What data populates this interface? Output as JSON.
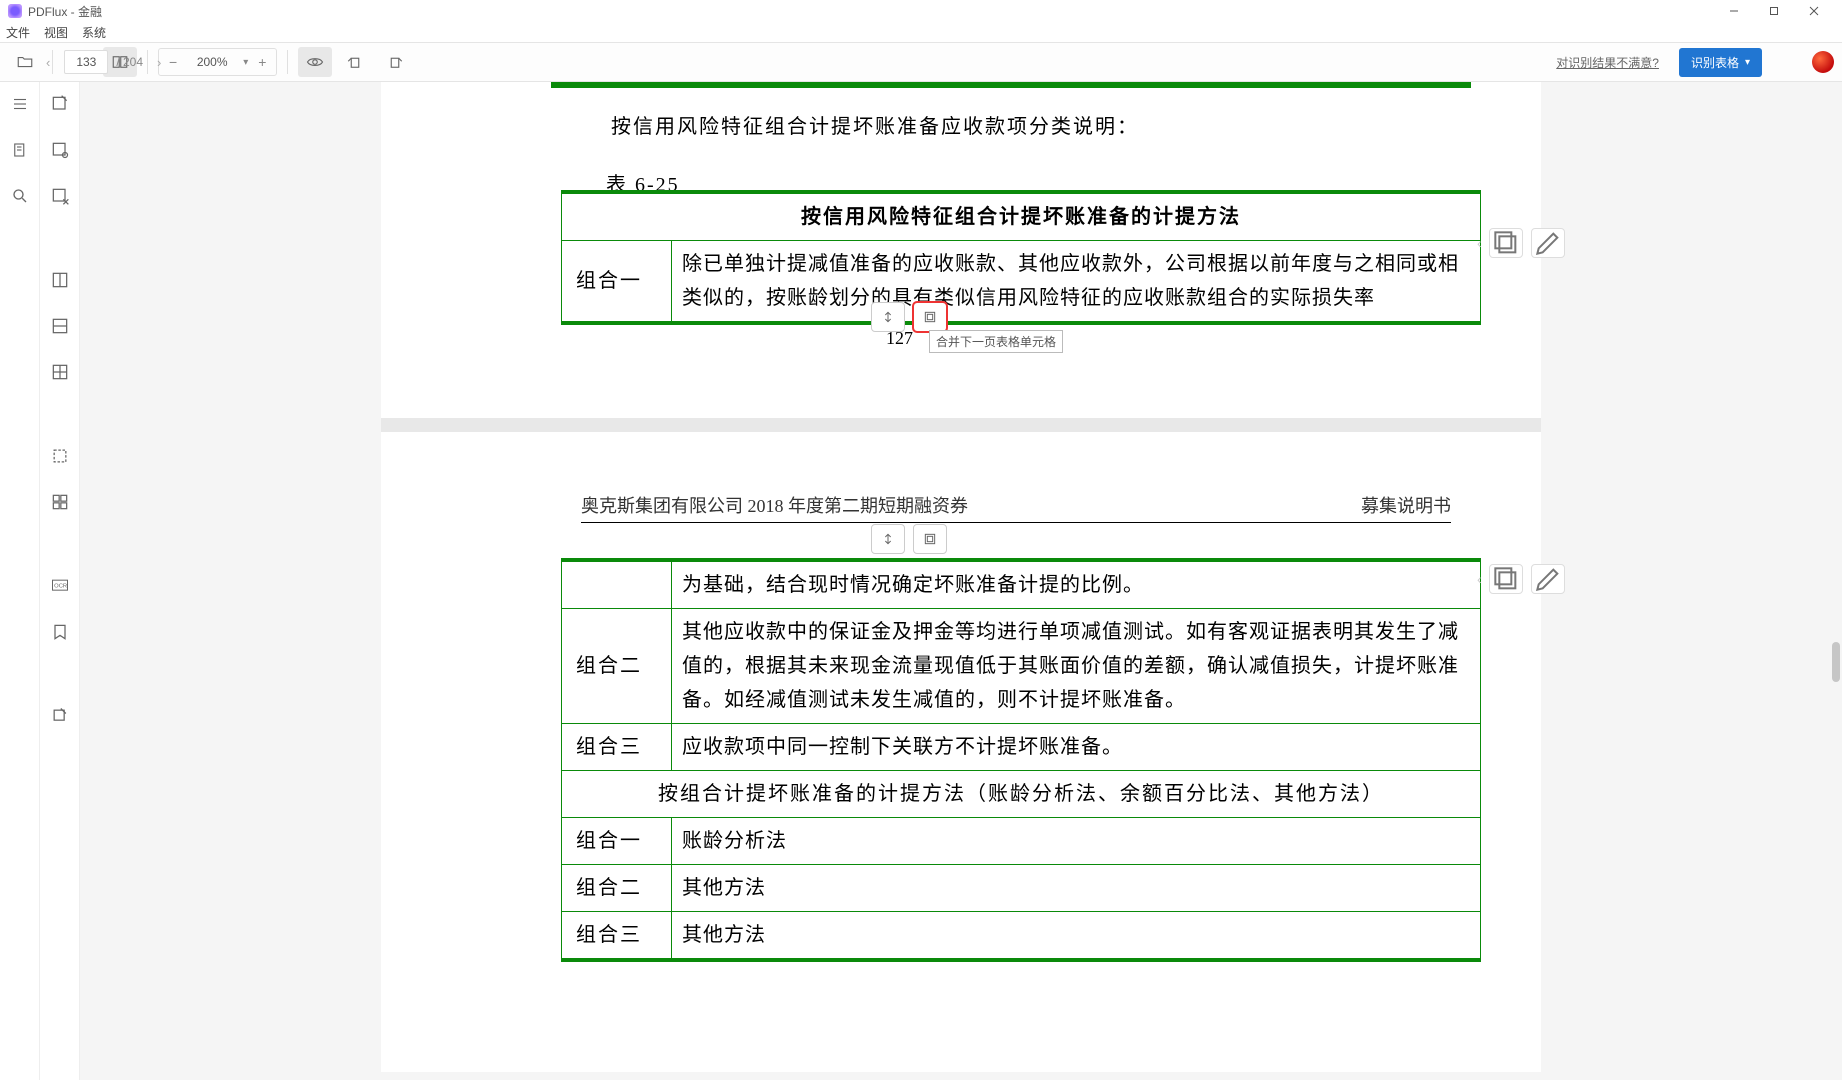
{
  "app": {
    "title": "PDFlux - 金融"
  },
  "menu": {
    "file": "文件",
    "view": "视图",
    "system": "系统"
  },
  "toolbar": {
    "zoom_value": "200%",
    "page_current": "133",
    "page_total": "/ 204",
    "feedback_link": "对识别结果不满意?",
    "recognize_btn": "识别表格"
  },
  "page1": {
    "intro_text": "按信用风险特征组合计提坏账准备应收款项分类说明：",
    "table_label": "表 6-25",
    "table1_header": "按信用风险特征组合计提坏账准备的计提方法",
    "row1_label": "组合一",
    "row1_text": "除已单独计提减值准备的应收账款、其他应收款外，公司根据以前年度与之相同或相类似的，按账龄划分的具有类似信用风险特征的应收账款组合的实际损失率",
    "page_number": "127",
    "tooltip": "合并下一页表格单元格"
  },
  "page2": {
    "header_left": "奥克斯集团有限公司 2018 年度第二期短期融资券",
    "header_right": "募集说明书",
    "row_cont_text": "为基础，结合现时情况确定坏账准备计提的比例。",
    "row2_label": "组合二",
    "row2_text": "其他应收款中的保证金及押金等均进行单项减值测试。如有客观证据表明其发生了减值的，根据其未来现金流量现值低于其账面价值的差额，确认减值损失，计提坏账准备。如经减值测试未发生减值的，则不计提坏账准备。",
    "row3_label": "组合三",
    "row3_text": "应收款项中同一控制下关联方不计提坏账准备。",
    "section_header": "按组合计提坏账准备的计提方法（账龄分析法、余额百分比法、其他方法）",
    "m1_label": "组合一",
    "m1_text": "账龄分析法",
    "m2_label": "组合二",
    "m2_text": "其他方法",
    "m3_label": "组合三",
    "m3_text": "其他方法"
  }
}
